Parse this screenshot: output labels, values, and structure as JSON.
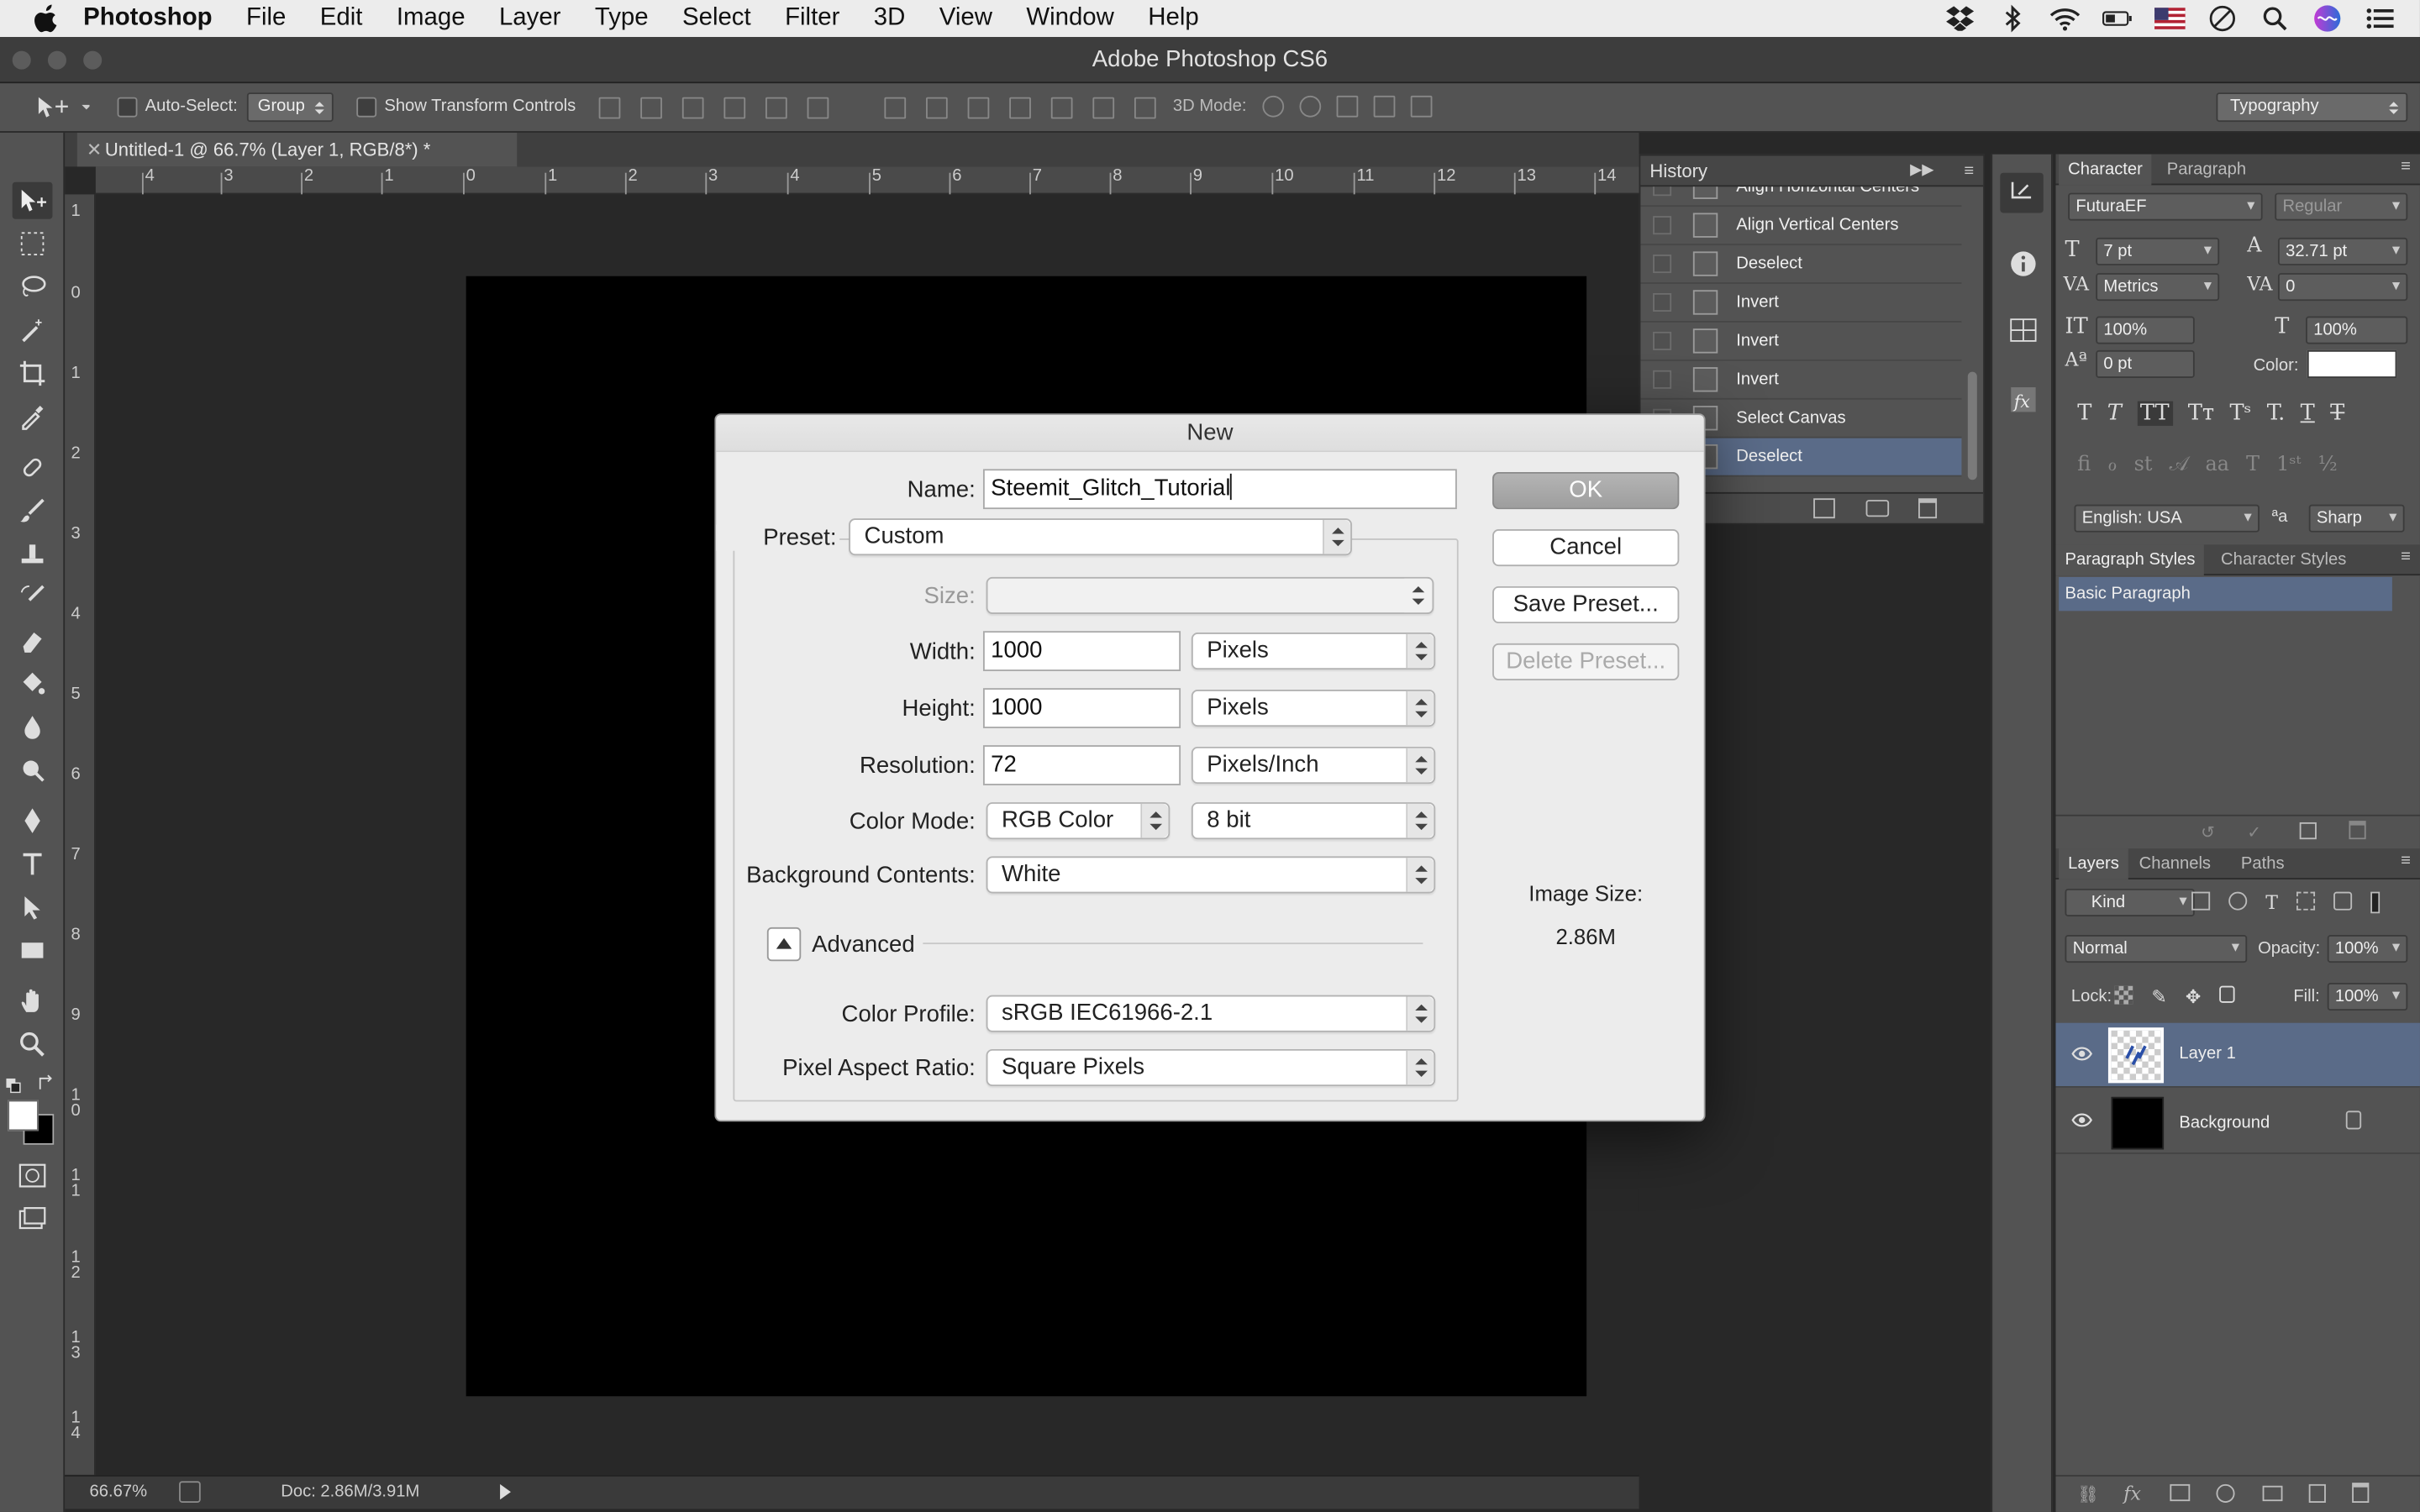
{
  "menubar": {
    "app": "Photoshop",
    "items": [
      "File",
      "Edit",
      "Image",
      "Layer",
      "Type",
      "Select",
      "Filter",
      "3D",
      "View",
      "Window",
      "Help"
    ]
  },
  "window": {
    "title": "Adobe Photoshop CS6"
  },
  "options_bar": {
    "auto_select_label": "Auto-Select:",
    "auto_select_value": "Group",
    "show_transform_label": "Show Transform Controls",
    "mode_3d_label": "3D Mode:",
    "workspace": "Typography"
  },
  "document": {
    "tab_title": "Untitled-1 @ 66.7% (Layer 1, RGB/8*) *",
    "zoom": "66.67%",
    "doc_info": "Doc: 2.86M/3.91M",
    "hruler": [
      "4",
      "3",
      "2",
      "1",
      "0",
      "1",
      "2",
      "3",
      "4",
      "5",
      "6",
      "7",
      "8",
      "9",
      "10",
      "11",
      "12",
      "13",
      "14"
    ],
    "vruler": [
      "1",
      "0",
      "1",
      "2",
      "3",
      "4",
      "5",
      "6",
      "7",
      "8",
      "9",
      "1\n0",
      "1\n1",
      "1\n2",
      "1\n3",
      "1\n4"
    ]
  },
  "history": {
    "title": "History",
    "items": [
      {
        "label": "Align Horizontal Centers",
        "selected": false
      },
      {
        "label": "Align Vertical Centers",
        "selected": false
      },
      {
        "label": "Deselect",
        "selected": false
      },
      {
        "label": "Invert",
        "selected": false
      },
      {
        "label": "Invert",
        "selected": false
      },
      {
        "label": "Invert",
        "selected": false
      },
      {
        "label": "Select Canvas",
        "selected": false
      },
      {
        "label": "Deselect",
        "selected": true
      }
    ]
  },
  "character": {
    "tab_character": "Character",
    "tab_paragraph": "Paragraph",
    "font_family": "FuturaEF",
    "font_style": "Regular",
    "size": "7 pt",
    "leading": "32.71 pt",
    "kerning": "Metrics",
    "tracking": "0",
    "vscale": "100%",
    "hscale": "100%",
    "baseline": "0 pt",
    "color_label": "Color:",
    "color": "#ffffff",
    "language": "English: USA",
    "aa_label": "ªa",
    "antialias": "Sharp"
  },
  "styles": {
    "tab_paragraph_styles": "Paragraph Styles",
    "tab_character_styles": "Character Styles",
    "item": "Basic Paragraph"
  },
  "layers": {
    "tab_layers": "Layers",
    "tab_channels": "Channels",
    "tab_paths": "Paths",
    "filter": "Kind",
    "blend": "Normal",
    "opacity_label": "Opacity:",
    "opacity": "100%",
    "lock_label": "Lock:",
    "fill_label": "Fill:",
    "fill": "100%",
    "items": [
      {
        "name": "Layer 1",
        "selected": true
      },
      {
        "name": "Background",
        "selected": false
      }
    ]
  },
  "dialog": {
    "title": "New",
    "name_label": "Name:",
    "name_value": "Steemit_Glitch_Tutorial",
    "preset_label": "Preset:",
    "preset_value": "Custom",
    "size_label": "Size:",
    "width_label": "Width:",
    "width_value": "1000",
    "width_unit": "Pixels",
    "height_label": "Height:",
    "height_value": "1000",
    "height_unit": "Pixels",
    "resolution_label": "Resolution:",
    "resolution_value": "72",
    "resolution_unit": "Pixels/Inch",
    "color_mode_label": "Color Mode:",
    "color_mode_value": "RGB Color",
    "bit_depth": "8 bit",
    "background_label": "Background Contents:",
    "background_value": "White",
    "advanced_label": "Advanced",
    "color_profile_label": "Color Profile:",
    "color_profile_value": "sRGB IEC61966-2.1",
    "pixel_aspect_label": "Pixel Aspect Ratio:",
    "pixel_aspect_value": "Square Pixels",
    "ok": "OK",
    "cancel": "Cancel",
    "save_preset": "Save Preset...",
    "delete_preset": "Delete Preset...",
    "image_size_label": "Image Size:",
    "image_size_value": "2.86M"
  }
}
